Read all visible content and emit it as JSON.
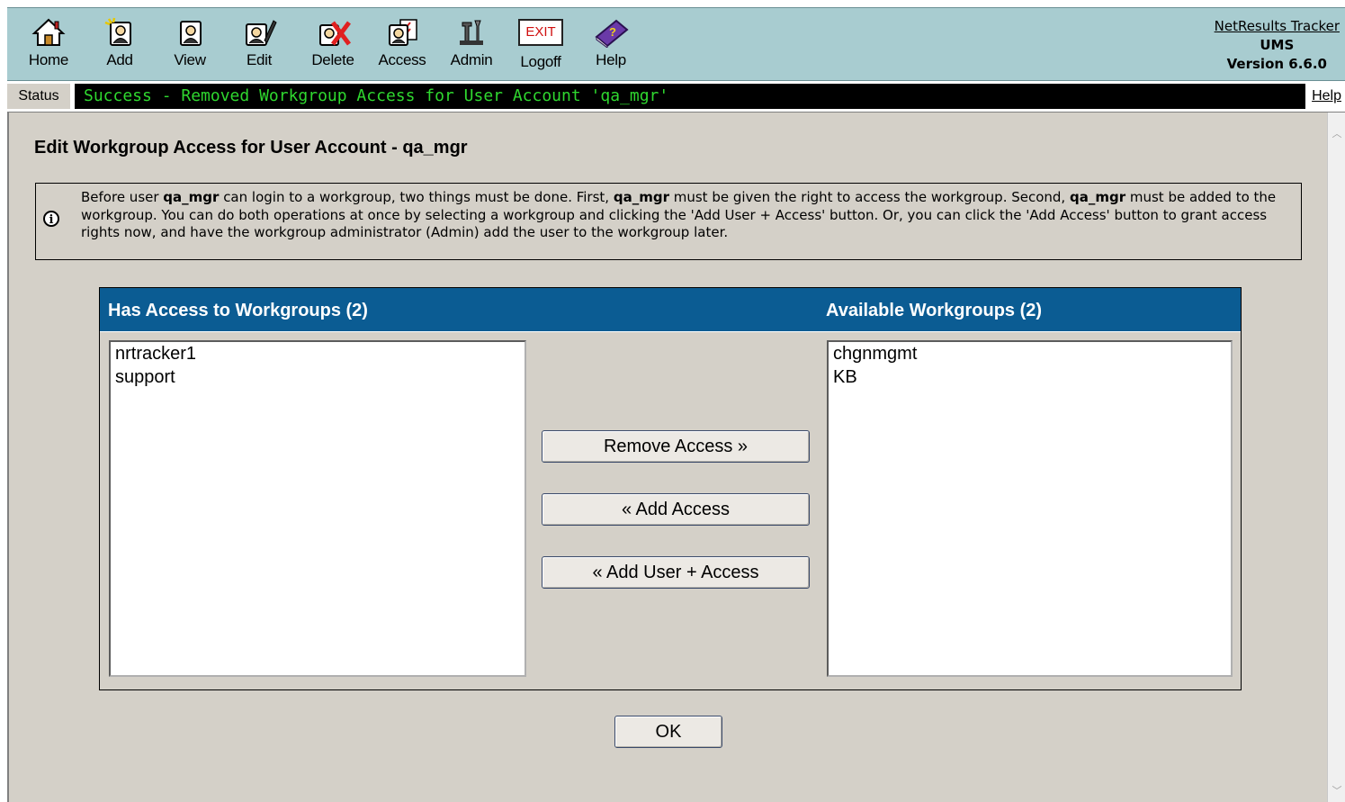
{
  "toolbar": {
    "items": [
      {
        "label": "Home",
        "icon": "home-icon"
      },
      {
        "label": "Add",
        "icon": "add-user-icon"
      },
      {
        "label": "View",
        "icon": "view-user-icon"
      },
      {
        "label": "Edit",
        "icon": "edit-user-icon"
      },
      {
        "label": "Delete",
        "icon": "delete-user-icon"
      },
      {
        "label": "Access",
        "icon": "access-user-icon"
      },
      {
        "label": "Admin",
        "icon": "admin-tools-icon"
      },
      {
        "label": "Logoff",
        "icon": "exit-icon"
      },
      {
        "label": "Help",
        "icon": "help-book-icon"
      }
    ],
    "exit_text": "EXIT",
    "help_glyph": "?"
  },
  "brand": {
    "link": "NetResults Tracker",
    "product": "UMS",
    "version": "Version 6.6.0"
  },
  "status": {
    "label": "Status",
    "message": "Success - Removed Workgroup Access for User Account 'qa_mgr'",
    "help": "Help",
    "message_color": "#2fd82f"
  },
  "page": {
    "title": "Edit Workgroup Access for User Account - qa_mgr"
  },
  "info": {
    "icon_glyph": "i",
    "user": "qa_mgr",
    "t1": "Before user ",
    "t2": " can login to a workgroup, two things must be done. First, ",
    "t3": " must be given the right to access the workgroup. Second, ",
    "t4": " must be added to the workgroup. You can do both operations at once by selecting a workgroup and clicking the 'Add User + Access' button. Or, you can click the 'Add Access' button to grant access rights now, and have the workgroup administrator (Admin) add the user to the workgroup later."
  },
  "panel": {
    "left_header": "Has Access to Workgroups (2)",
    "right_header": "Available Workgroups (2)",
    "header_color": "#0b5c93",
    "has_access": [
      "nrtracker1",
      "support"
    ],
    "available": [
      "chgnmgmt",
      "KB"
    ],
    "buttons": {
      "remove": "Remove Access »",
      "add": "« Add Access",
      "add_user": "« Add User + Access"
    }
  },
  "ok_label": "OK"
}
